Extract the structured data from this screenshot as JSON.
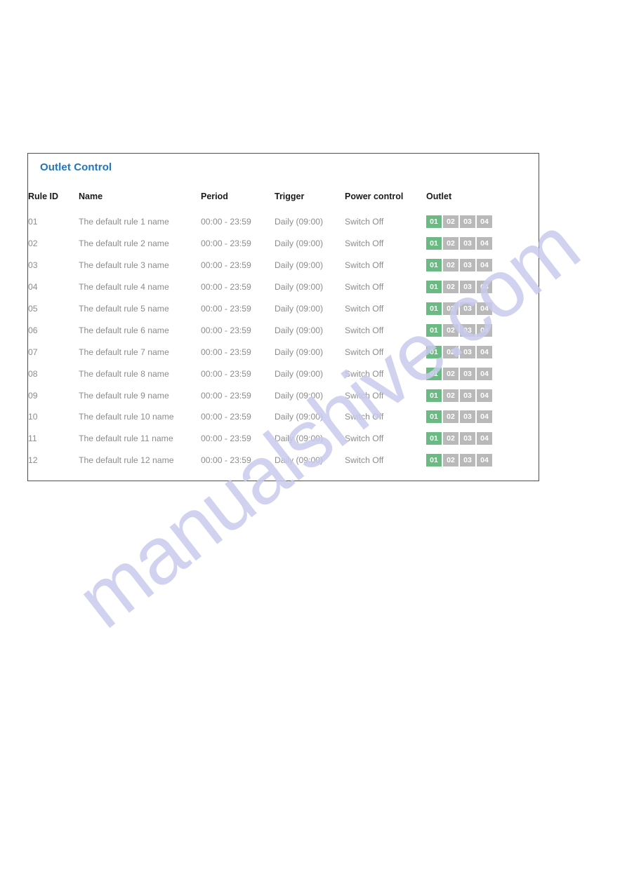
{
  "panel": {
    "title": "Outlet Control"
  },
  "table": {
    "headers": {
      "rule_id": "Rule ID",
      "name": "Name",
      "period": "Period",
      "trigger": "Trigger",
      "power_control": "Power control",
      "outlet": "Outlet"
    },
    "rows": [
      {
        "rule_id": "01",
        "name": "The default rule 1 name",
        "period": "00:00 - 23:59",
        "trigger": "Daily (09:00)",
        "power_control": "Switch Off",
        "outlets": [
          {
            "label": "01",
            "state": "on"
          },
          {
            "label": "02",
            "state": "off"
          },
          {
            "label": "03",
            "state": "off"
          },
          {
            "label": "04",
            "state": "off"
          }
        ]
      },
      {
        "rule_id": "02",
        "name": "The default rule 2 name",
        "period": "00:00 - 23:59",
        "trigger": "Daily (09:00)",
        "power_control": "Switch Off",
        "outlets": [
          {
            "label": "01",
            "state": "on"
          },
          {
            "label": "02",
            "state": "off"
          },
          {
            "label": "03",
            "state": "off"
          },
          {
            "label": "04",
            "state": "off"
          }
        ]
      },
      {
        "rule_id": "03",
        "name": "The default rule 3 name",
        "period": "00:00 - 23:59",
        "trigger": "Daily (09:00)",
        "power_control": "Switch Off",
        "outlets": [
          {
            "label": "01",
            "state": "on"
          },
          {
            "label": "02",
            "state": "off"
          },
          {
            "label": "03",
            "state": "off"
          },
          {
            "label": "04",
            "state": "off"
          }
        ]
      },
      {
        "rule_id": "04",
        "name": "The default rule 4 name",
        "period": "00:00 - 23:59",
        "trigger": "Daily (09:00)",
        "power_control": "Switch Off",
        "outlets": [
          {
            "label": "01",
            "state": "on"
          },
          {
            "label": "02",
            "state": "off"
          },
          {
            "label": "03",
            "state": "off"
          },
          {
            "label": "04",
            "state": "off"
          }
        ]
      },
      {
        "rule_id": "05",
        "name": "The default rule 5 name",
        "period": "00:00 - 23:59",
        "trigger": "Daily (09:00)",
        "power_control": "Switch Off",
        "outlets": [
          {
            "label": "01",
            "state": "on"
          },
          {
            "label": "02",
            "state": "off"
          },
          {
            "label": "03",
            "state": "off"
          },
          {
            "label": "04",
            "state": "off"
          }
        ]
      },
      {
        "rule_id": "06",
        "name": "The default rule 6 name",
        "period": "00:00 - 23:59",
        "trigger": "Daily (09:00)",
        "power_control": "Switch Off",
        "outlets": [
          {
            "label": "01",
            "state": "on"
          },
          {
            "label": "02",
            "state": "off"
          },
          {
            "label": "03",
            "state": "off"
          },
          {
            "label": "04",
            "state": "off"
          }
        ]
      },
      {
        "rule_id": "07",
        "name": "The default rule 7 name",
        "period": "00:00 - 23:59",
        "trigger": "Daily (09:00)",
        "power_control": "Switch Off",
        "outlets": [
          {
            "label": "01",
            "state": "on"
          },
          {
            "label": "02",
            "state": "off"
          },
          {
            "label": "03",
            "state": "off"
          },
          {
            "label": "04",
            "state": "off"
          }
        ]
      },
      {
        "rule_id": "08",
        "name": "The default rule 8 name",
        "period": "00:00 - 23:59",
        "trigger": "Daily (09:00)",
        "power_control": "Switch Off",
        "outlets": [
          {
            "label": "01",
            "state": "on"
          },
          {
            "label": "02",
            "state": "off"
          },
          {
            "label": "03",
            "state": "off"
          },
          {
            "label": "04",
            "state": "off"
          }
        ]
      },
      {
        "rule_id": "09",
        "name": "The default rule 9 name",
        "period": "00:00 - 23:59",
        "trigger": "Daily (09:00)",
        "power_control": "Switch Off",
        "outlets": [
          {
            "label": "01",
            "state": "on"
          },
          {
            "label": "02",
            "state": "off"
          },
          {
            "label": "03",
            "state": "off"
          },
          {
            "label": "04",
            "state": "off"
          }
        ]
      },
      {
        "rule_id": "10",
        "name": "The default rule 10 name",
        "period": "00:00 - 23:59",
        "trigger": "Daily (09:00)",
        "power_control": "Switch Off",
        "outlets": [
          {
            "label": "01",
            "state": "on"
          },
          {
            "label": "02",
            "state": "off"
          },
          {
            "label": "03",
            "state": "off"
          },
          {
            "label": "04",
            "state": "off"
          }
        ]
      },
      {
        "rule_id": "11",
        "name": "The default rule 11 name",
        "period": "00:00 - 23:59",
        "trigger": "Daily (09:00)",
        "power_control": "Switch Off",
        "outlets": [
          {
            "label": "01",
            "state": "on"
          },
          {
            "label": "02",
            "state": "off"
          },
          {
            "label": "03",
            "state": "off"
          },
          {
            "label": "04",
            "state": "off"
          }
        ]
      },
      {
        "rule_id": "12",
        "name": "The default rule 12 name",
        "period": "00:00 - 23:59",
        "trigger": "Daily (09:00)",
        "power_control": "Switch Off",
        "outlets": [
          {
            "label": "01",
            "state": "on"
          },
          {
            "label": "02",
            "state": "off"
          },
          {
            "label": "03",
            "state": "off"
          },
          {
            "label": "04",
            "state": "off"
          }
        ]
      }
    ]
  },
  "watermark": {
    "text": "manualshive.com"
  },
  "colors": {
    "title": "#2176bc",
    "outlet_on": "#6cba83",
    "outlet_off": "#b9b9b9",
    "rule_id": "#a6c0d2",
    "body_text": "#8c8c8c",
    "watermark": "#c9cbed",
    "panel_border": "#4d4d4d"
  }
}
